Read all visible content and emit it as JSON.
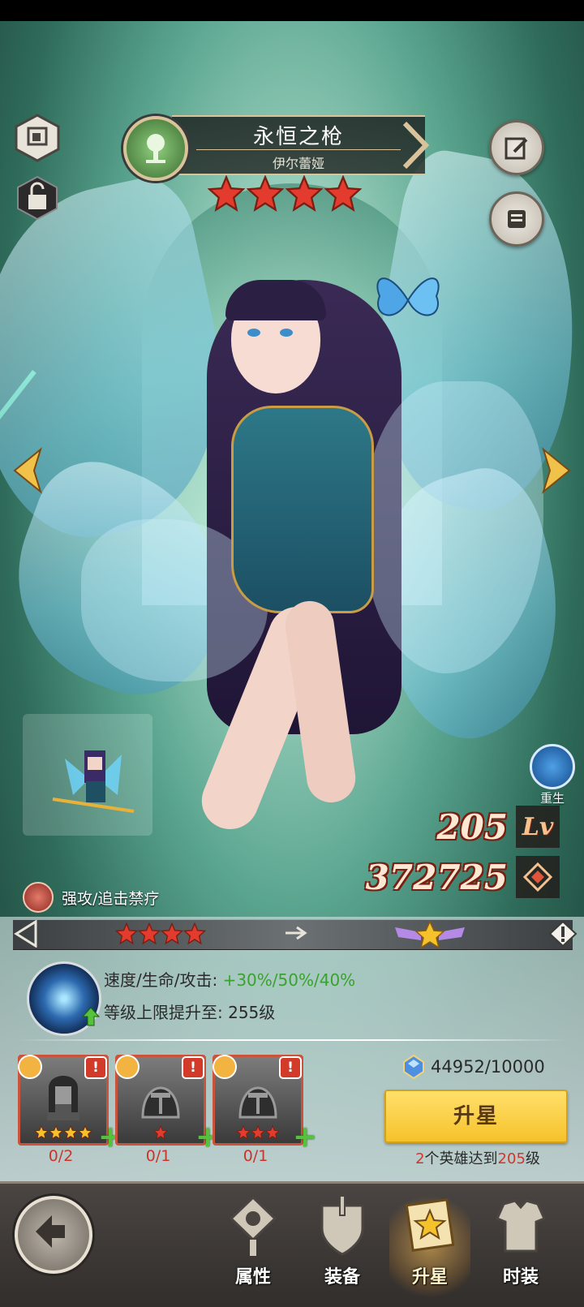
{
  "hero": {
    "title": "永恒之枪",
    "name": "伊尔蕾娅",
    "star_count": 4,
    "skill_label": "强攻/追击禁疗",
    "level": "205",
    "level_tag": "Lv",
    "power": "372725",
    "rebirth_label": "重生"
  },
  "star_upgrade": {
    "current_stars": 4,
    "bonus_label": "速度/生命/攻击:",
    "bonus_value": "+30%/50%/40%",
    "level_cap_label": "等级上限提升至:",
    "level_cap_value": "255级",
    "materials": [
      {
        "badge": "tree",
        "stars": 4,
        "count": "0/2"
      },
      {
        "badge": "tree",
        "stars": 1,
        "count": "0/1"
      },
      {
        "badge": "ALL",
        "stars": 3,
        "count": "0/1"
      }
    ],
    "currency": "44952/10000",
    "button_label": "升星",
    "condition_prefix": "2",
    "condition_mid": "个英雄达到",
    "condition_level": "205",
    "condition_suffix": "级"
  },
  "nav": {
    "tabs": [
      {
        "label": "属性",
        "active": false
      },
      {
        "label": "装备",
        "active": false
      },
      {
        "label": "升星",
        "active": true
      },
      {
        "label": "时装",
        "active": false
      }
    ]
  },
  "colors": {
    "star_red": "#e33b2e",
    "accent_gold": "#f6c22b",
    "bonus_green": "#3aa22e",
    "alert_red": "#d2352a"
  }
}
